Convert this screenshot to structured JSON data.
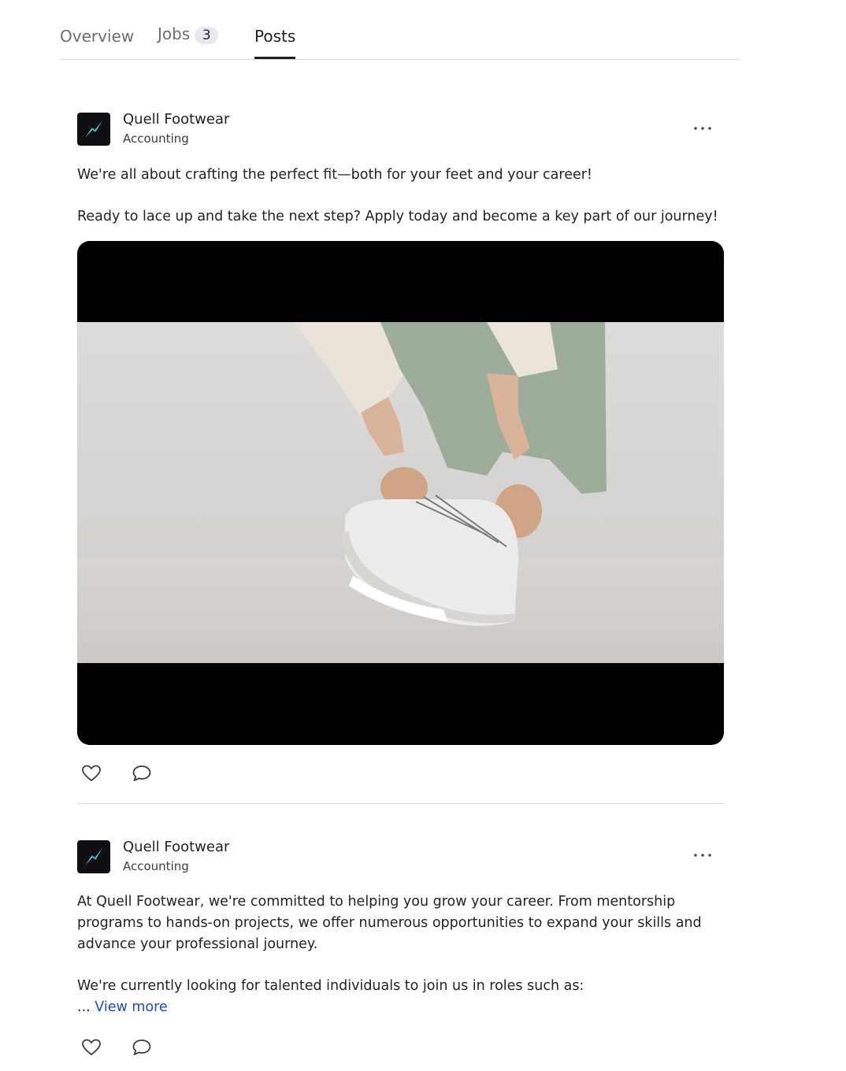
{
  "tabs": [
    {
      "label": "Overview",
      "active": false
    },
    {
      "label": "Jobs",
      "count": "3",
      "active": false
    },
    {
      "label": "Posts",
      "active": true
    }
  ],
  "posts": [
    {
      "company": "Quell Footwear",
      "industry": "Accounting",
      "paragraphs": [
        "We're all about crafting the perfect fit—both for your feet and your career!",
        "Ready to lace up and take the next step? Apply today and become a key part of our journey!"
      ],
      "media": "video-player"
    },
    {
      "company": "Quell Footwear",
      "industry": "Accounting",
      "paragraphs": [
        "At Quell Footwear, we're committed to helping you grow your career. From mentorship programs to hands-on projects, we offer numerous opportunities to expand your skills and advance your professional journey.",
        "We're currently looking for talented individuals to join us in roles such as:"
      ],
      "ellipsis": "...",
      "view_more": "View more"
    }
  ],
  "icons": {
    "logo": "lightning-bolt-icon",
    "more": "more-options-icon",
    "like": "heart-icon",
    "comment": "comment-bubble-icon"
  },
  "colors": {
    "link": "#2348c8",
    "logo_bg": "#101014",
    "logo_bolt": "#5fd8f0"
  }
}
